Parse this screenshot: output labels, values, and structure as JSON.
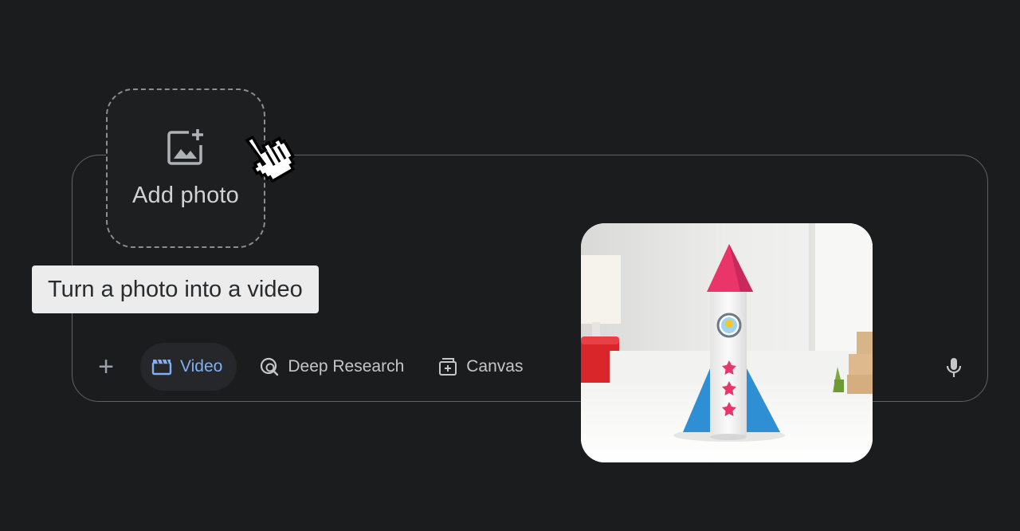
{
  "add_photo": {
    "label": "Add photo",
    "icon": "add-photo-icon"
  },
  "tooltip": {
    "text": "Turn a photo into a video"
  },
  "toolbar": {
    "plus_icon": "plus-icon",
    "tools": [
      {
        "label": "Video",
        "icon": "video-clapper-icon",
        "active": true
      },
      {
        "label": "Deep Research",
        "icon": "deep-research-icon",
        "active": false
      },
      {
        "label": "Canvas",
        "icon": "canvas-icon",
        "active": false
      }
    ],
    "mic_icon": "microphone-icon"
  },
  "cursor": {
    "icon": "hand-pointer-cursor"
  },
  "colors": {
    "background": "#1b1c1d",
    "active_accent": "#7fb0f5",
    "text_muted": "#c4c7c5",
    "tooltip_bg": "#ececec"
  }
}
